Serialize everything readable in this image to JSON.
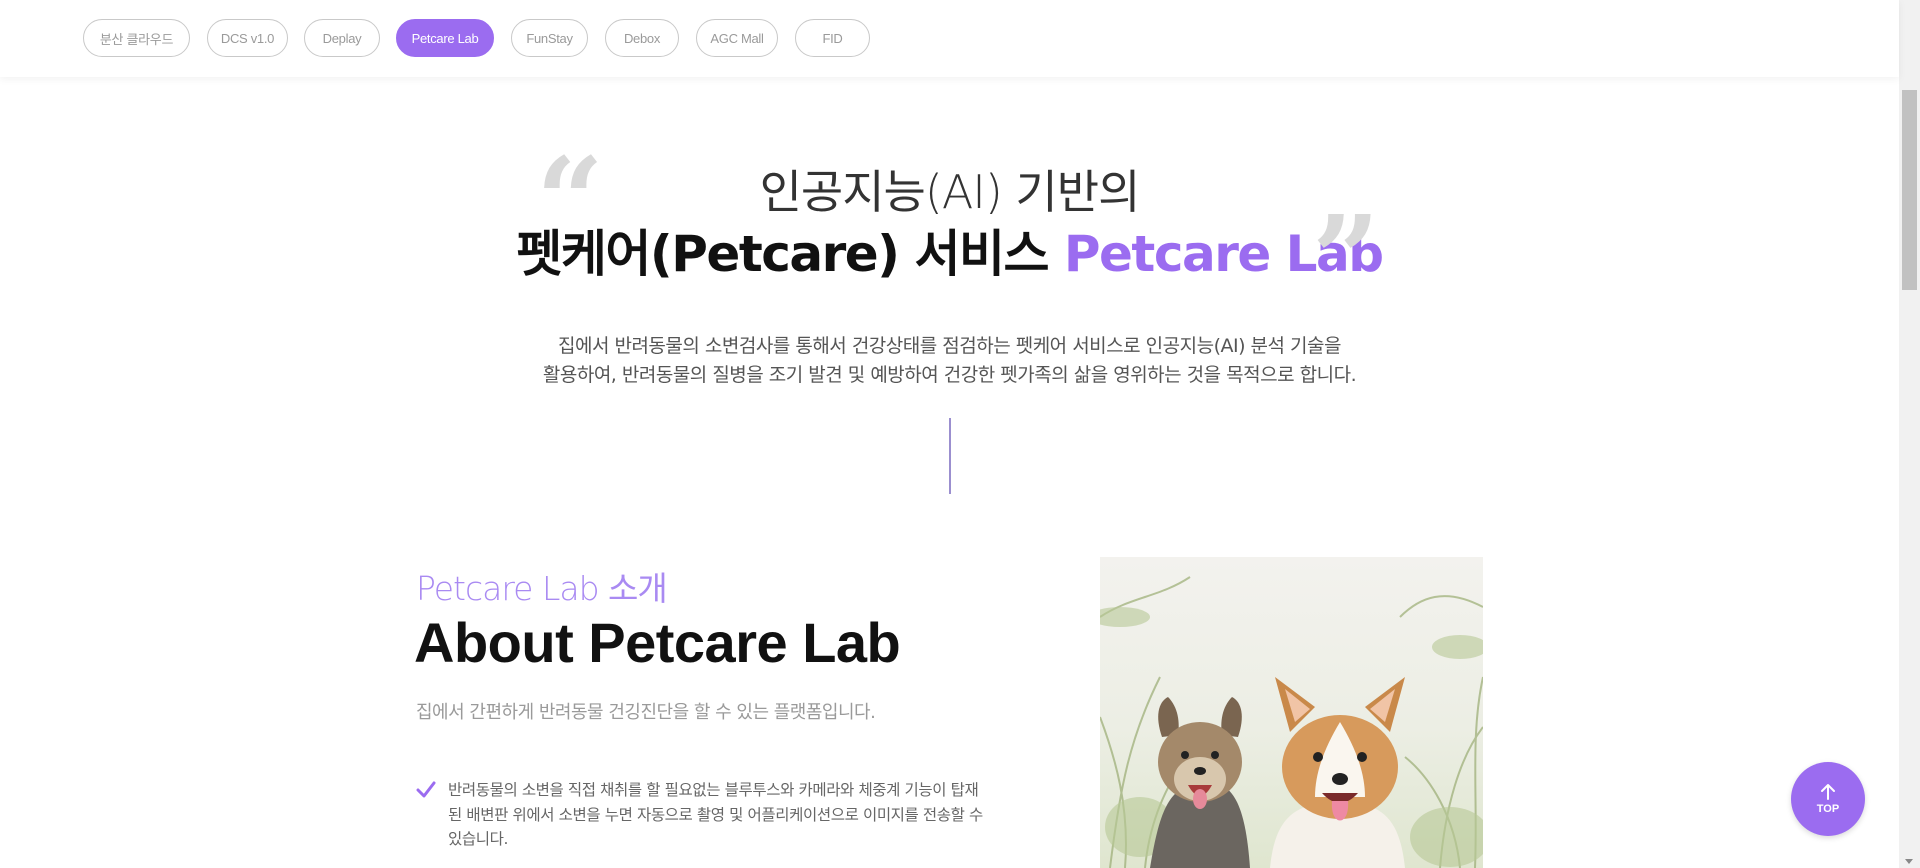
{
  "tabs": [
    {
      "label": "분산 클라우드",
      "active": false
    },
    {
      "label": "DCS v1.0",
      "active": false
    },
    {
      "label": "Deplay",
      "active": false
    },
    {
      "label": "Petcare Lab",
      "active": true
    },
    {
      "label": "FunStay",
      "active": false
    },
    {
      "label": "Debox",
      "active": false
    },
    {
      "label": "AGC Mall",
      "active": false
    },
    {
      "label": "FID",
      "active": false
    }
  ],
  "hero": {
    "line1": "인공지능(AI) 기반의",
    "line2_main": "펫케어(Petcare) 서비스 ",
    "line2_accent": "Petcare Lab",
    "quote_open": "“",
    "quote_close": "”",
    "desc_line1": "집에서 반려동물의 소변검사를 통해서 건강상태를 점검하는 펫케어 서비스로 인공지능(AI) 분석 기술을",
    "desc_line2": "활용하여, 반려동물의 질병을 조기 발견 및 예방하여 건강한 펫가족의 삶을 영위하는 것을 목적으로 합니다."
  },
  "about": {
    "eyebrow": "Petcare Lab 소개",
    "title": "About Petcare Lab",
    "subtitle": "집에서 간편하게 반려동물 건깅진단을 할 수 있는 플랫폼입니다.",
    "features": [
      "반려동물의 소변을 직접 채취를 할 필요없는 블루투스와 카메라와 체중계 기능이 탑재된 배변판 위에서 소변을 누면 자동으로 촬영 및 어플리케이션으로 이미지를 전송할 수 있습니다."
    ]
  },
  "top_button": {
    "label": "TOP"
  },
  "colors": {
    "accent": "#9b6cf0",
    "accent_light": "#a98af2",
    "divider": "#9b8fcf"
  },
  "icons": {
    "check": "check-icon",
    "arrow_up": "arrow-up-icon"
  }
}
